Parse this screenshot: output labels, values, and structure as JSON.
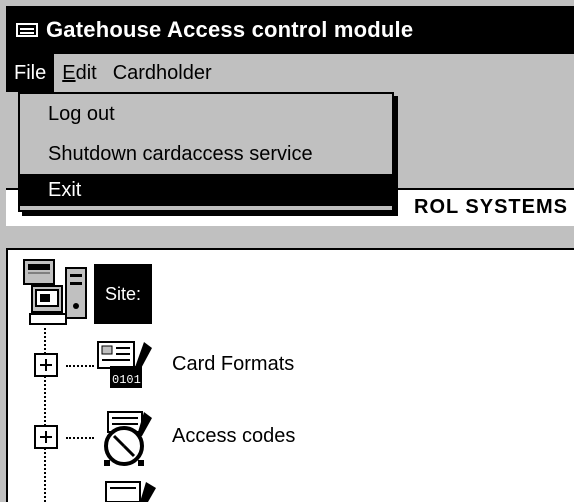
{
  "window": {
    "title": "Gatehouse Access control module"
  },
  "menubar": {
    "items": [
      {
        "label": "File",
        "active": true
      },
      {
        "label": "Edit",
        "mnemonic": "E"
      },
      {
        "label": "Cardholder"
      }
    ]
  },
  "file_menu": {
    "items": [
      {
        "label": "Log out"
      },
      {
        "label": "Shutdown cardaccess service"
      },
      {
        "label": "Exit",
        "highlighted": true
      }
    ]
  },
  "banner": {
    "text": "ROL SYSTEMS"
  },
  "tree": {
    "root": {
      "label": "Site:"
    },
    "children": [
      {
        "label": "Card Formats",
        "icon": "card-formats-icon"
      },
      {
        "label": "Access codes",
        "icon": "access-codes-icon"
      }
    ]
  }
}
